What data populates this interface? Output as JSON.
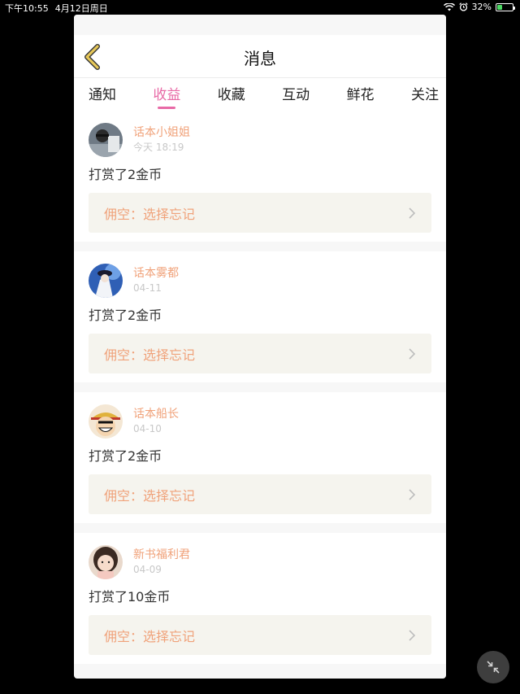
{
  "status_bar": {
    "time": "下午10:55",
    "date": "4月12日周日",
    "battery": "32%"
  },
  "nav": {
    "title": "消息"
  },
  "tabs": [
    {
      "label": "通知",
      "active": false
    },
    {
      "label": "收益",
      "active": true
    },
    {
      "label": "收藏",
      "active": false
    },
    {
      "label": "互动",
      "active": false
    },
    {
      "label": "鲜花",
      "active": false
    },
    {
      "label": "关注",
      "active": false
    }
  ],
  "messages": [
    {
      "name": "话本小姐姐",
      "time": "今天 18:19",
      "text": "打赏了2金币",
      "quote": "佣空：选择忘记",
      "avatar": "avatar-1"
    },
    {
      "name": "话本雾都",
      "time": "04-11",
      "text": "打赏了2金币",
      "quote": "佣空：选择忘记",
      "avatar": "avatar-2"
    },
    {
      "name": "话本船长",
      "time": "04-10",
      "text": "打赏了2金币",
      "quote": "佣空：选择忘记",
      "avatar": "avatar-3"
    },
    {
      "name": "新书福利君",
      "time": "04-09",
      "text": "打赏了10金币",
      "quote": "佣空：选择忘记",
      "avatar": "avatar-4"
    }
  ],
  "colors": {
    "accent": "#e86aa6",
    "name": "#f0a27a",
    "quote_bg": "#f5f4ee",
    "back_icon": "#d4b24a"
  },
  "icons": {
    "back": "chevron-left-icon",
    "quote_arrow": "chevron-right-icon",
    "floating": "collapse-icon"
  }
}
